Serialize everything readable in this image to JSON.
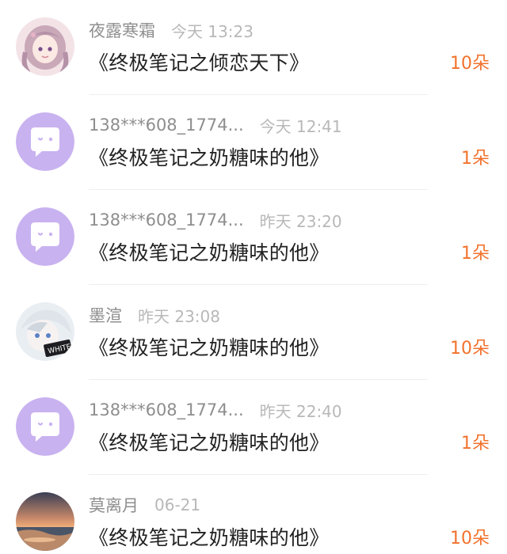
{
  "colors": {
    "gift_accent": "#f2722c",
    "name_gray": "#8e8e8e",
    "time_gray": "#b8b8b8",
    "default_avatar_purple": "#c9b2f0"
  },
  "rows": [
    {
      "avatar_icon": "anime-girl-avatar",
      "name": "夜露寒霜",
      "time": "今天 13:23",
      "title": "《终极笔记之倾恋天下》",
      "gift": "10朵"
    },
    {
      "avatar_icon": "chat-bubble-default-avatar",
      "name": "138***608_1774...",
      "time": "今天 12:41",
      "title": "《终极笔记之奶糖味的他》",
      "gift": "1朵"
    },
    {
      "avatar_icon": "chat-bubble-default-avatar",
      "name": "138***608_1774...",
      "time": "昨天 23:20",
      "title": "《终极笔记之奶糖味的他》",
      "gift": "1朵"
    },
    {
      "avatar_icon": "anime-boy-avatar",
      "name": "墨渲",
      "time": "昨天 23:08",
      "title": "《终极笔记之奶糖味的他》",
      "gift": "10朵"
    },
    {
      "avatar_icon": "chat-bubble-default-avatar",
      "name": "138***608_1774...",
      "time": "昨天 22:40",
      "title": "《终极笔记之奶糖味的他》",
      "gift": "1朵"
    },
    {
      "avatar_icon": "sunset-landscape-avatar",
      "name": "莫离月",
      "time": "06-21",
      "title": "《终极笔记之奶糖味的他》",
      "gift": "10朵"
    }
  ]
}
